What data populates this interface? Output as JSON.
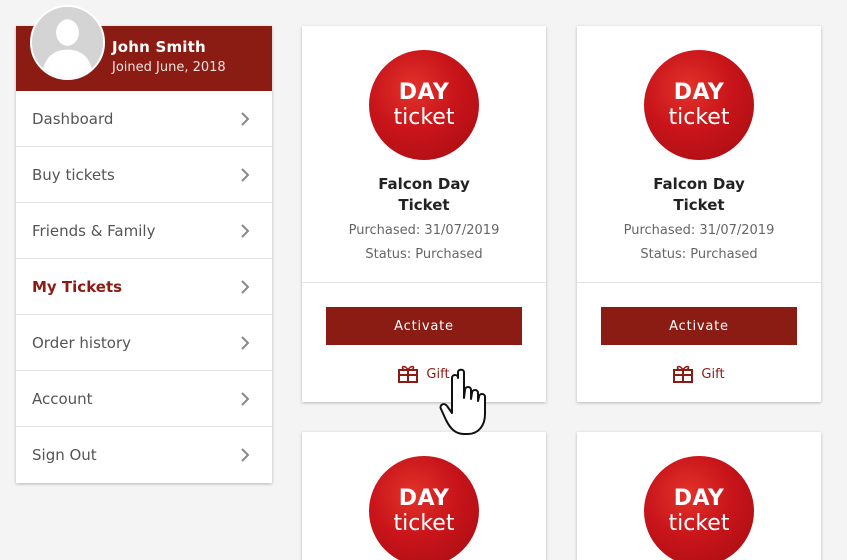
{
  "profile": {
    "name": "John Smith",
    "joined": "Joined June, 2018"
  },
  "nav": {
    "items": [
      {
        "label": "Dashboard",
        "active": false
      },
      {
        "label": "Buy tickets",
        "active": false
      },
      {
        "label": "Friends & Family",
        "active": false
      },
      {
        "label": "My Tickets",
        "active": true
      },
      {
        "label": "Order history",
        "active": false
      },
      {
        "label": "Account",
        "active": false
      },
      {
        "label": "Sign Out",
        "active": false
      }
    ]
  },
  "tickets": [
    {
      "badge_top": "DAY",
      "badge_bottom": "ticket",
      "title": "Falcon Day Ticket",
      "purchased": "Purchased: 31/07/2019",
      "status": "Status: Purchased",
      "activate_label": "Activate",
      "gift_label": "Gift"
    },
    {
      "badge_top": "DAY",
      "badge_bottom": "ticket",
      "title": "Falcon Day Ticket",
      "purchased": "Purchased: 31/07/2019",
      "status": "Status: Purchased",
      "activate_label": "Activate",
      "gift_label": "Gift"
    },
    {
      "badge_top": "DAY",
      "badge_bottom": "ticket"
    },
    {
      "badge_top": "DAY",
      "badge_bottom": "ticket"
    }
  ],
  "colors": {
    "brand": "#8a1c14",
    "badge_red": "#c8141a",
    "background": "#f4f4f4"
  },
  "icons": {
    "nav_chevron": "chevron-right-icon",
    "gift": "gift-icon",
    "avatar": "user-silhouette-icon",
    "pointer": "hand-pointer-icon"
  }
}
